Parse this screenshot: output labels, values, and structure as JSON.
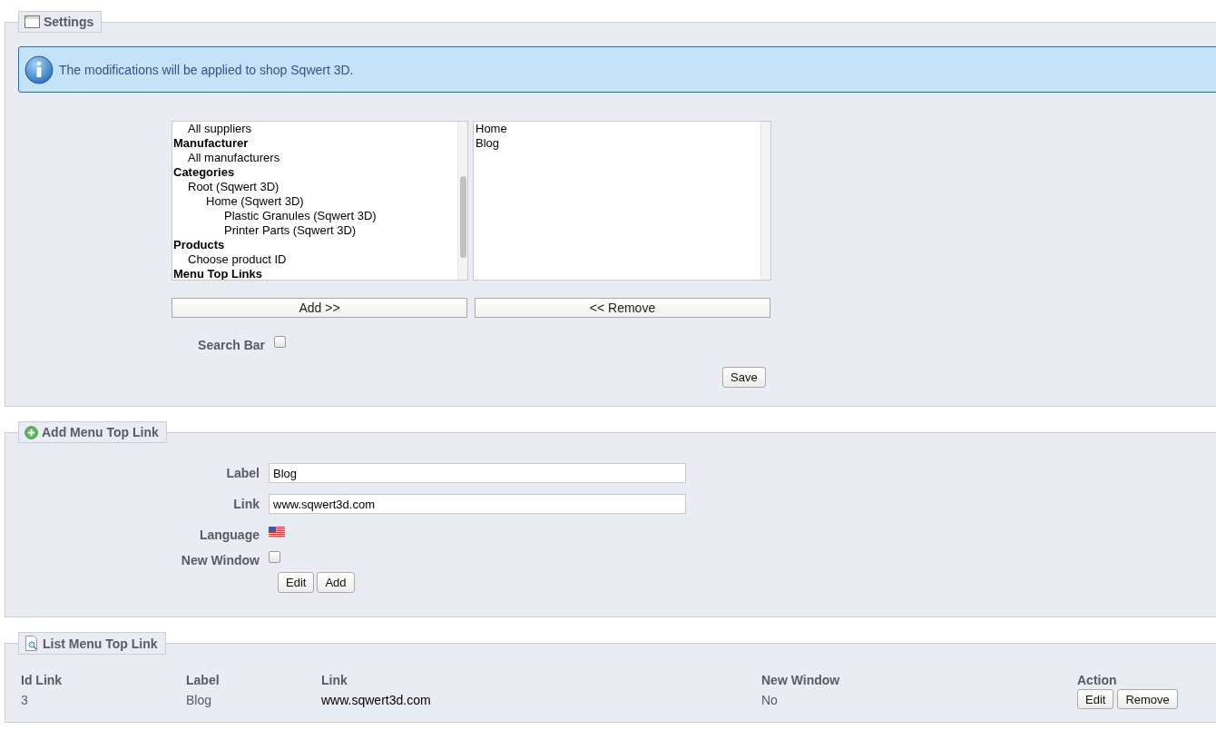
{
  "settings": {
    "legend": "Settings",
    "info": "The modifications will be applied to shop Sqwert 3D.",
    "available_items": [
      {
        "label": "All suppliers",
        "kind": "option"
      },
      {
        "label": "Manufacturer",
        "kind": "group",
        "children": [
          {
            "label": "All manufacturers",
            "kind": "option"
          }
        ]
      },
      {
        "label": "Categories",
        "kind": "group",
        "children": [
          {
            "label": "Root (Sqwert 3D)",
            "kind": "option",
            "children": [
              {
                "label": "Home (Sqwert 3D)",
                "kind": "option",
                "children": [
                  {
                    "label": "Plastic Granules (Sqwert 3D)",
                    "kind": "option"
                  },
                  {
                    "label": "Printer Parts (Sqwert 3D)",
                    "kind": "option"
                  }
                ]
              }
            ]
          }
        ]
      },
      {
        "label": "Products",
        "kind": "group",
        "children": [
          {
            "label": "Choose product ID",
            "kind": "option"
          }
        ]
      },
      {
        "label": "Menu Top Links",
        "kind": "group"
      }
    ],
    "selected_items": [
      "Home",
      "Blog"
    ],
    "add_button": "Add >>",
    "remove_button": "<< Remove",
    "search_bar": {
      "label": "Search Bar",
      "checked": false
    },
    "save_button": "Save"
  },
  "add_link": {
    "legend": "Add Menu Top Link",
    "fields": [
      {
        "label": "Label",
        "value": "Blog"
      },
      {
        "label": "Link",
        "value": "www.sqwert3d.com"
      }
    ],
    "language_label": "Language",
    "new_window": {
      "label": "New Window",
      "checked": false
    },
    "buttons": [
      "Edit",
      "Add"
    ]
  },
  "list_links": {
    "legend": "List Menu Top Link",
    "columns": [
      "Id Link",
      "Label",
      "Link",
      "New Window",
      "Action"
    ],
    "rows": [
      {
        "id": "3",
        "label": "Blog",
        "link": "www.sqwert3d.com",
        "new_window": "No",
        "actions": [
          "Edit",
          "Remove"
        ]
      }
    ]
  }
}
